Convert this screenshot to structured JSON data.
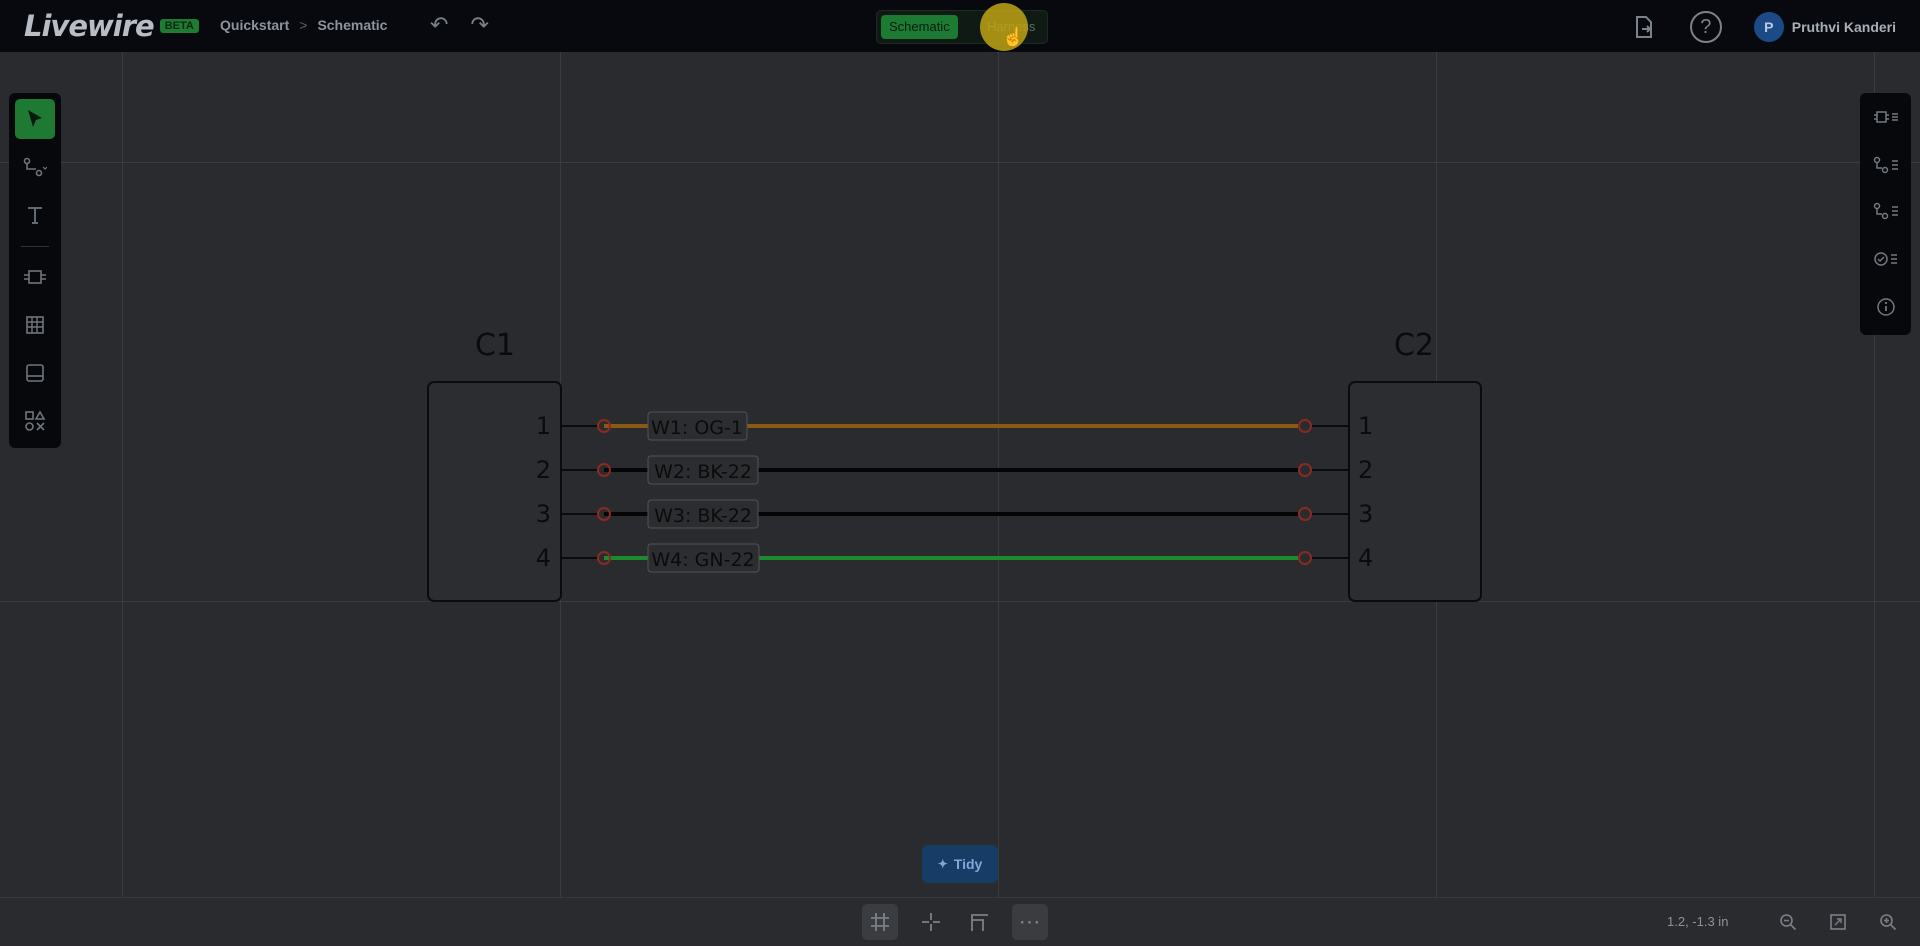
{
  "app": {
    "logo_text": "Livewire",
    "logo_badge": "BETA",
    "breadcrumb": [
      "Quickstart",
      "Schematic"
    ],
    "breadcrumb_sep": ">"
  },
  "view_toggle": {
    "schematic_label": "Schematic",
    "harness_label": "Harness",
    "active": "Schematic"
  },
  "user": {
    "initial": "P",
    "name": "Pruthvi Kanderi"
  },
  "icons": {
    "undo": "undo-icon",
    "redo": "redo-icon",
    "export": "export-icon",
    "help": "help-icon",
    "select": "select-arrow-icon",
    "wire": "wire-tool-icon",
    "text": "text-tool-icon",
    "connector": "connector-tool-icon",
    "table": "table-tool-icon",
    "titleblock": "titleblock-icon",
    "shapes": "shapes-icon"
  },
  "colors": {
    "active_green": "#1e7a32",
    "wire_orange": "#8a5a12",
    "wire_black": "#050505",
    "wire_green": "#1e8a2e",
    "pin_red": "#8a2a22",
    "tidy_blue": "#173c66"
  },
  "schematic": {
    "connectors": [
      {
        "name": "C1",
        "pins": [
          "1",
          "2",
          "3",
          "4"
        ]
      },
      {
        "name": "C2",
        "pins": [
          "1",
          "2",
          "3",
          "4"
        ]
      }
    ],
    "wires": [
      {
        "label": "W1: OG-1",
        "color": "orange"
      },
      {
        "label": "W2: BK-22",
        "color": "black"
      },
      {
        "label": "W3: BK-22",
        "color": "black"
      },
      {
        "label": "W4: GN-22",
        "color": "green"
      }
    ]
  },
  "tidy": {
    "label": "Tidy"
  },
  "status": {
    "coords": "1.2, -1.3 in"
  }
}
